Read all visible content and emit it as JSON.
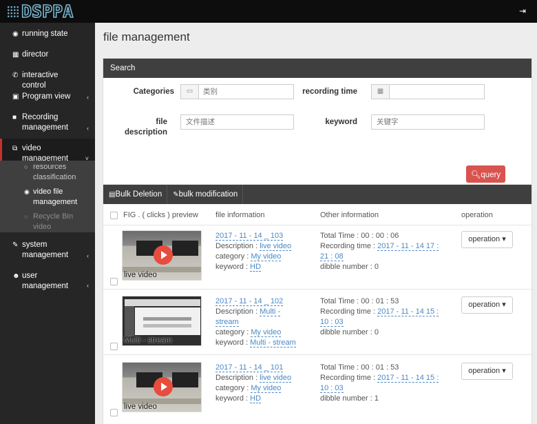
{
  "app": {
    "logo": "DSPPA",
    "logout_icon": "sign-out-icon"
  },
  "sidebar": {
    "items": [
      {
        "icon": "dashboard-icon",
        "glyph": "◉",
        "label": "running state"
      },
      {
        "icon": "director-icon",
        "glyph": "▦",
        "label": "director"
      },
      {
        "icon": "phone-icon",
        "glyph": "✆",
        "label": "interactive control"
      },
      {
        "icon": "program-icon",
        "glyph": "▣",
        "label": "Program view"
      },
      {
        "icon": "camera-icon",
        "glyph": "■",
        "label": "Recording management"
      },
      {
        "icon": "video-management-icon",
        "glyph": "⧉",
        "label": "video management"
      },
      {
        "icon": "wrench-icon",
        "glyph": "✎",
        "label": "system management"
      },
      {
        "icon": "users-icon",
        "glyph": "☻",
        "label": "user management"
      }
    ],
    "submenu": [
      {
        "label": "resources classification"
      },
      {
        "label": "video file management"
      },
      {
        "label": "Recycle Bin video"
      }
    ]
  },
  "page": {
    "title": "file management"
  },
  "search": {
    "heading": "Search",
    "categories_label": "Categories",
    "categories_placeholder": "类别",
    "recording_time_label": "recording time",
    "description_label": "file description",
    "description_placeholder": "文件描述",
    "keyword_label": "keyword",
    "keyword_placeholder": "关键字",
    "query_label": "query"
  },
  "toolbar": {
    "bulk_delete": "Bulk Deletion",
    "bulk_modify": "bulk modification"
  },
  "table": {
    "headers": [
      "FIG . ( clicks ) preview",
      "file information",
      "Other information",
      "operation"
    ],
    "rows": [
      {
        "thumb_caption": "live video",
        "name": "2017 - 11 - 14 _ 103",
        "desc_label": "Description : ",
        "desc_value": "live video",
        "cat_label": "category : ",
        "cat_value": "My video",
        "kw_label": "keyword : ",
        "kw_value": "HD",
        "total_time": "Total Time : 00 : 00 : 06",
        "rec_label": "Recording time : ",
        "rec_value_1": "2017 - 11 - 14 17 :",
        "rec_value_2": "21 : 08",
        "dibble": "dibble number : 0",
        "op_label": "operation"
      },
      {
        "thumb_caption": "Multi - stream",
        "name": "2017 - 11 - 14 _ 102",
        "desc_label": "Description : ",
        "desc_value": "Multi -",
        "desc_value_2": "stream",
        "cat_label": "category : ",
        "cat_value": "My video",
        "kw_label": "keyword : ",
        "kw_value": "Multi - stream",
        "total_time": "Total Time : 00 : 01 : 53",
        "rec_label": "Recording time : ",
        "rec_value_1": "2017 - 11 - 14 15 :",
        "rec_value_2": "10 : 03",
        "dibble": "dibble number : 0",
        "op_label": "operation"
      },
      {
        "thumb_caption": "live video",
        "name": "2017 - 11 - 14 _ 101",
        "desc_label": "Description : ",
        "desc_value": "live video",
        "cat_label": "category : ",
        "cat_value": "My video",
        "kw_label": "keyword : ",
        "kw_value": "HD",
        "total_time": "Total Time : 00 : 01 : 53",
        "rec_label": "Recording time : ",
        "rec_value_1": "2017 - 11 - 14 15 :",
        "rec_value_2": "10 : 03",
        "dibble": "dibble number : 1",
        "op_label": "operation"
      }
    ]
  }
}
